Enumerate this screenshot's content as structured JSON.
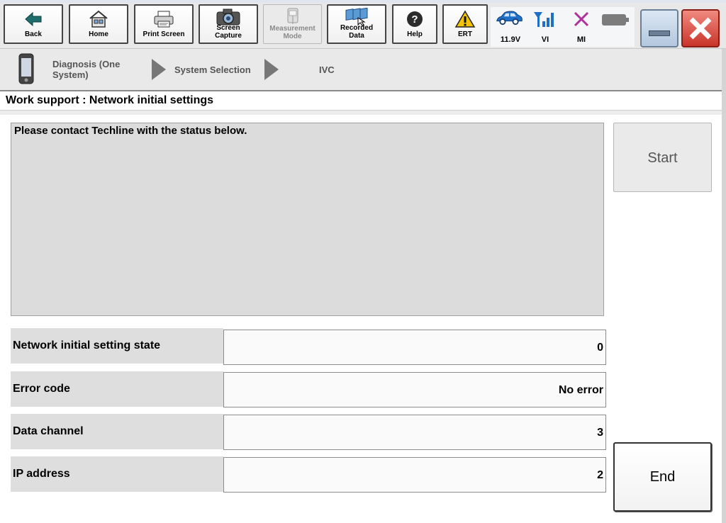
{
  "toolbar": {
    "buttons": [
      {
        "label": "Back",
        "icon": "back-arrow-icon",
        "enabled": true
      },
      {
        "label": "Home",
        "icon": "home-icon",
        "enabled": true
      },
      {
        "label": "Print Screen",
        "icon": "printer-icon",
        "enabled": true
      },
      {
        "label": "Screen\nCapture",
        "icon": "camera-icon",
        "enabled": true
      },
      {
        "label": "Measurement\nMode",
        "icon": "measurement-icon",
        "enabled": false
      },
      {
        "label": "Recorded\nData",
        "icon": "recorded-data-icon",
        "enabled": true
      },
      {
        "label": "Help",
        "icon": "help-icon",
        "enabled": true
      },
      {
        "label": "ERT",
        "icon": "warning-icon",
        "enabled": true
      }
    ]
  },
  "status": {
    "battery_voltage": "11.9V",
    "vi_label": "VI",
    "mi_label": "MI"
  },
  "breadcrumb": {
    "step1": "Diagnosis (One System)",
    "step2": "System Selection",
    "step3": "IVC"
  },
  "page": {
    "title": "Work support : Network initial settings",
    "message": "Please contact Techline with the status below."
  },
  "fields": [
    {
      "label": "Network initial setting state",
      "value": "0"
    },
    {
      "label": "Error code",
      "value": "No error"
    },
    {
      "label": "Data channel",
      "value": "3"
    },
    {
      "label": "IP address",
      "value": "2"
    }
  ],
  "actions": {
    "start_label": "Start",
    "end_label": "End"
  },
  "colors": {
    "accent_blue": "#1f6fc7",
    "mi_magenta": "#b0309a",
    "close_red": "#d9534f"
  }
}
